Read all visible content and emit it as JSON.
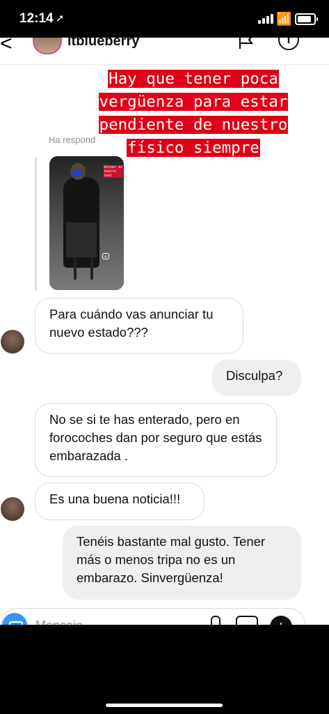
{
  "status_bar": {
    "time": "12:14",
    "location_icon": "location-arrow-icon"
  },
  "header": {
    "username": "itblueberry"
  },
  "story_reply": {
    "caption_lines": [
      "Hay que tener poca",
      "vergüenza para estar",
      "pendiente de nuestro",
      "físico siempre"
    ],
    "reply_label": "Ha respond",
    "story_tag": "Volver al teatro real",
    "caption_color": "#e10016"
  },
  "messages": [
    {
      "direction": "in",
      "text": "Para cuándo vas anunciar tu nuevo estado???"
    },
    {
      "direction": "out",
      "text": "Disculpa?"
    },
    {
      "direction": "in",
      "text": "No  se si te has enterado, pero en forocoches dan por seguro que estás embarazada ."
    },
    {
      "direction": "in",
      "text": "Es una buena noticia!!!"
    },
    {
      "direction": "out",
      "text": "Tenéis bastante mal gusto. Tener más o menos tripa no es un embarazo. Sinvergüenza!"
    }
  ],
  "composer": {
    "placeholder": "Mensaje..."
  }
}
